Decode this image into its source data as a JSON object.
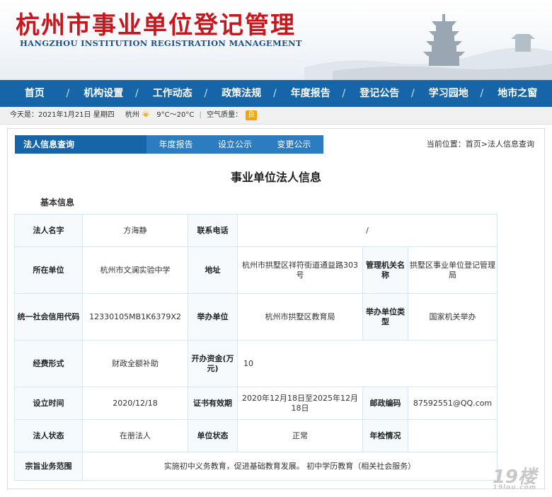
{
  "banner": {
    "title": "杭州市事业单位登记管理",
    "subtitle": "HANGZHOU INSTITUTION REGISTRATION MANAGEMENT"
  },
  "nav": [
    "首页",
    "机构设置",
    "工作动态",
    "政策法规",
    "年度报告",
    "登记公告",
    "学习园地",
    "地市之窗"
  ],
  "infobar": {
    "date": "今天是：2021年1月21日 星期四",
    "city": "杭州",
    "temp": "9°C～20°C",
    "aq_label": "空气质量：",
    "aq_value": "良",
    "aq_color": "#f4a300"
  },
  "tabbar": {
    "active": "法人信息查询",
    "tabs": [
      "年度报告",
      "设立公示",
      "变更公示"
    ],
    "breadcrumb": "当前位置：首页>法人信息查询"
  },
  "page_title": "事业单位法人信息",
  "section_label": "基本信息",
  "table": {
    "name_label": "法人名字",
    "name": "方海静",
    "phone_label": "联系电话",
    "phone": "/",
    "unit_label": "所在单位",
    "unit": "杭州市文澜实验中学",
    "addr_label": "地址",
    "addr": "杭州市拱墅区祥符街道通益路303号",
    "authority_label": "管理机关名称",
    "authority": "拱墅区事业单位登记管理局",
    "credit_label": "统一社会信用代码",
    "credit": "12330105MB1K6379X2",
    "sponsor_label": "举办单位",
    "sponsor": "杭州市拱墅区教育局",
    "sponsor_type_label": "举办单位类型",
    "sponsor_type": "国家机关举办",
    "fund_label": "经费形式",
    "fund": "财政全额补助",
    "capital_label": "开办资金(万元)",
    "capital": "10",
    "setup_label": "设立时间",
    "setup": "2020/12/18",
    "valid_label": "证书有效期",
    "valid": "2020年12月18日至2025年12月18日",
    "post_label": "邮政编码",
    "post": "87592551@QQ.com",
    "status_label": "法人状态",
    "status": "在册法人",
    "unit_status_label": "单位状态",
    "unit_status": "正常",
    "check_label": "年检情况",
    "check": "",
    "scope_label": "宗旨业务范围",
    "scope": "实施初中义务教育，促进基础教育发展。 初中学历教育（相关社会服务）"
  },
  "watermark": {
    "main": "19楼",
    "small": "19lou.com"
  }
}
